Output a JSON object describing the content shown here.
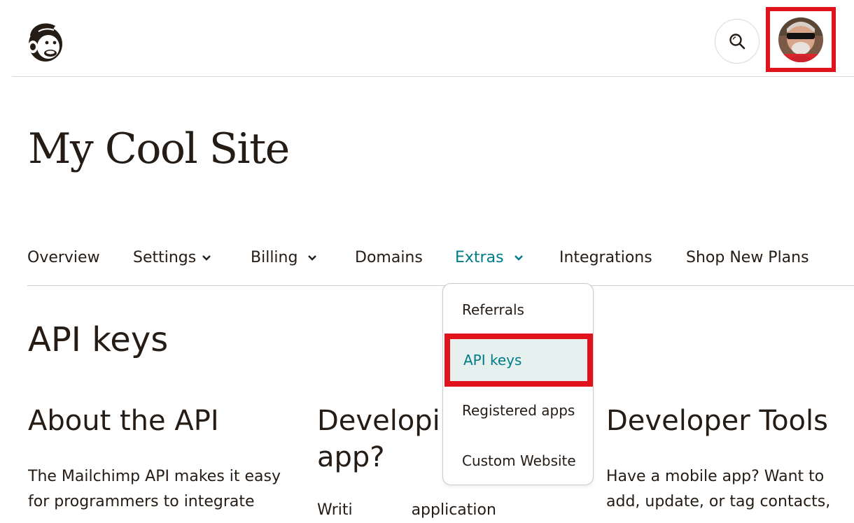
{
  "header": {
    "logo_icon": "mailchimp-freddie-logo",
    "search_icon": "search-icon",
    "avatar_alt": "user-avatar"
  },
  "site_title": "My Cool Site",
  "nav": {
    "items": [
      {
        "label": "Overview"
      },
      {
        "label": "Settings"
      },
      {
        "label": "Billing"
      },
      {
        "label": "Domains"
      },
      {
        "label": "Extras"
      },
      {
        "label": "Integrations"
      },
      {
        "label": "Shop New Plans"
      }
    ],
    "active": "Extras"
  },
  "page_heading": "API keys",
  "columns": [
    {
      "heading": "About the API",
      "text": "The Mailchimp API makes it easy\nfor programmers to integrate"
    },
    {
      "heading": "Developir\napp?",
      "text": "Writi            application"
    },
    {
      "heading": "Developer Tools",
      "text": "Have a mobile app? Want to\nadd, update, or tag contacts,"
    }
  ],
  "dropdown": {
    "items": [
      {
        "label": "Referrals"
      },
      {
        "label": "API keys"
      },
      {
        "label": "Registered apps"
      },
      {
        "label": "Custom Website"
      }
    ],
    "selected": "API keys"
  },
  "colors": {
    "accent": "#007c89",
    "highlight_border": "#e0121b",
    "selected_bg": "#e6f1ef",
    "text": "#241c15"
  }
}
